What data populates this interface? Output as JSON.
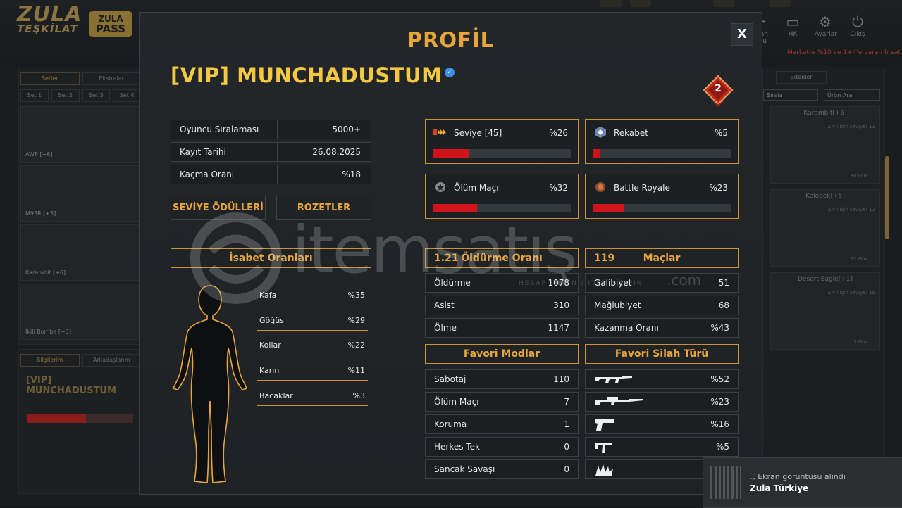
{
  "background": {
    "logo_line1": "ZULA",
    "logo_line2": "TEŞKİLAT",
    "pass_line1": "ZULA",
    "pass_line2": "PASS",
    "top_icons": [
      {
        "label": "Silah Yolu",
        "icon": "gun-icon"
      },
      {
        "label": "HK",
        "icon": "wallet-icon"
      },
      {
        "label": "Ayarlar",
        "icon": "gear-icon"
      },
      {
        "label": "Çıkış",
        "icon": "power-icon"
      }
    ],
    "promo": "Markette %10 ve 1+4'e varan fırsat",
    "left_tabs": [
      "Setler",
      "Ekstralar"
    ],
    "set_tabs": [
      "Set 1",
      "Set 2",
      "Set 3",
      "Set 4"
    ],
    "left_items": [
      "AWP [+6]",
      "M93R [+5]",
      "Karambit [+6]",
      "İkili Bomba [+3]"
    ],
    "bottom_tabs": [
      "Bilgilerim",
      "Arkadaşlarım"
    ],
    "bottom_name": "[VIP] MUNCHADUSTUM",
    "right_tab": "Bitenler",
    "right_select": "Sırala",
    "right_search": "Ürün Ara",
    "right_items": [
      {
        "name": "Karambit[+6]",
        "req": "ZP'li için seviye: 11",
        "days": "30 Gün"
      },
      {
        "name": "Kelebek[+5]",
        "req": "ZP'li için seviye: 12",
        "days": "12 Gün"
      },
      {
        "name": "Desert Eagle[+1]",
        "req": "ZP'li için seviye: 19",
        "days": "5 Gün"
      }
    ]
  },
  "modal": {
    "title": "PROFİL",
    "close": "X",
    "player_name": "[VIP] MUNCHADUSTUM",
    "rank_number": "2",
    "info_rows": [
      {
        "label": "Oyuncu Sıralaması",
        "value": "5000+"
      },
      {
        "label": "Kayıt Tarihi",
        "value": "26.08.2025"
      },
      {
        "label": "Kaçma Oranı",
        "value": "%18"
      }
    ],
    "buttons": {
      "rewards": "SEVİYE ÖDÜLLERİ",
      "badges": "ROZETLER"
    },
    "progress": [
      {
        "label": "Seviye [45]",
        "pct": "%26",
        "value": 0.26,
        "icon": "level-chevron-icon"
      },
      {
        "label": "Rekabet",
        "pct": "%5",
        "value": 0.05,
        "icon": "competitive-icon"
      },
      {
        "label": "Ölüm Maçı",
        "pct": "%32",
        "value": 0.32,
        "icon": "deathmatch-icon"
      },
      {
        "label": "Battle Royale",
        "pct": "%23",
        "value": 0.23,
        "icon": "battle-royale-icon"
      }
    ],
    "accuracy": {
      "title": "İsabet Oranları",
      "rows": [
        {
          "label": "Kafa",
          "value": "%35"
        },
        {
          "label": "Göğüs",
          "value": "%29"
        },
        {
          "label": "Kollar",
          "value": "%22"
        },
        {
          "label": "Karın",
          "value": "%11"
        },
        {
          "label": "Bacaklar",
          "value": "%3"
        }
      ]
    },
    "kills": {
      "ratio": "1.21",
      "title": "Öldürme Oranı",
      "rows": [
        {
          "label": "Öldürme",
          "value": "1078"
        },
        {
          "label": "Asist",
          "value": "310"
        },
        {
          "label": "Ölme",
          "value": "1147"
        }
      ]
    },
    "matches": {
      "count": "119",
      "title": "Maçlar",
      "rows": [
        {
          "label": "Galibiyet",
          "value": "51"
        },
        {
          "label": "Mağlubiyet",
          "value": "68"
        },
        {
          "label": "Kazanma Oranı",
          "value": "%43"
        }
      ]
    },
    "fav_modes": {
      "title": "Favori Modlar",
      "rows": [
        {
          "label": "Sabotaj",
          "value": "110"
        },
        {
          "label": "Ölüm Maçı",
          "value": "7"
        },
        {
          "label": "Koruma",
          "value": "1"
        },
        {
          "label": "Herkes Tek",
          "value": "0"
        },
        {
          "label": "Sancak Savaşı",
          "value": "0"
        }
      ]
    },
    "fav_weapons": {
      "title": "Favori Silah Türü",
      "rows": [
        {
          "icon": "assault-rifle-icon",
          "value": "%52"
        },
        {
          "icon": "sniper-rifle-icon",
          "value": "%23"
        },
        {
          "icon": "pistol-icon",
          "value": "%16"
        },
        {
          "icon": "smg-icon",
          "value": "%5"
        },
        {
          "icon": "melee-icon",
          "value": ""
        }
      ]
    }
  },
  "watermark": {
    "text": "itemsatış",
    "sub": "HESAP / SKIN / ITEM / E-PIN",
    "com": ".com"
  },
  "toast": {
    "line1": "Ekran görüntüsü alındı",
    "line2": "Zula Türkiye"
  }
}
